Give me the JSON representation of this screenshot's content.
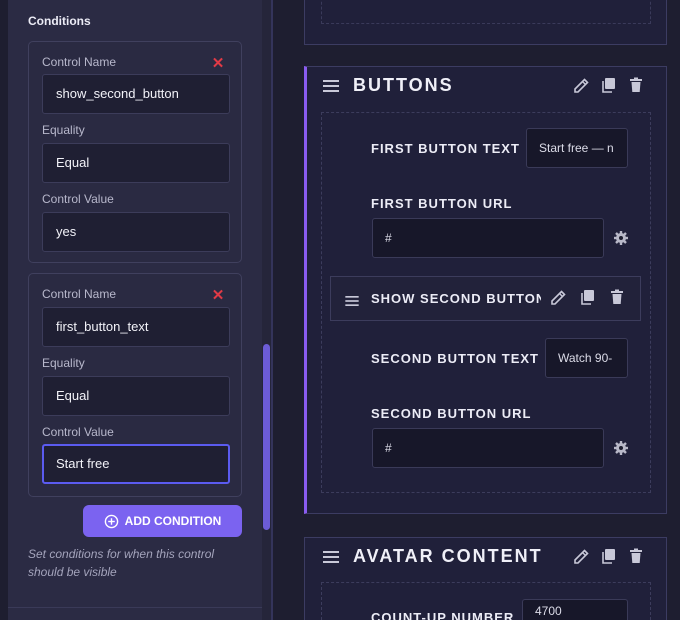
{
  "conditions": {
    "section_label": "Conditions",
    "items": [
      {
        "control_name_label": "Control Name",
        "control_name_value": "show_second_button",
        "equality_label": "Equality",
        "equality_value": "Equal",
        "control_value_label": "Control Value",
        "control_value_value": "yes"
      },
      {
        "control_name_label": "Control Name",
        "control_name_value": "first_button_text",
        "equality_label": "Equality",
        "equality_value": "Equal",
        "control_value_label": "Control Value",
        "control_value_value": "Start free"
      }
    ],
    "remove_icon": "close-x-icon",
    "add_button_label": "ADD CONDITION",
    "add_icon": "plus-circle-icon",
    "help_text": "Set conditions for when this control should be visible"
  },
  "blocks": {
    "buttons": {
      "title": "BUTTONS",
      "first_button_text_label": "FIRST BUTTON TEXT",
      "first_button_text_value": "Start free — n",
      "first_button_url_label": "FIRST BUTTON URL",
      "first_button_url_value": "#",
      "show_second_button_label": "SHOW SECOND BUTTON",
      "second_button_text_label": "SECOND BUTTON TEXT",
      "second_button_text_value": "Watch 90-",
      "second_button_url_label": "SECOND BUTTON URL",
      "second_button_url_value": "#"
    },
    "avatar": {
      "title": "AVATAR CONTENT",
      "count_up_number_label": "COUNT-UP NUMBER",
      "count_up_number_value": "4700"
    }
  },
  "colors": {
    "accent": "#7b63f0",
    "active_border": "#8a5cf0",
    "remove": "#e03a46",
    "focus": "#5b5bf0"
  }
}
